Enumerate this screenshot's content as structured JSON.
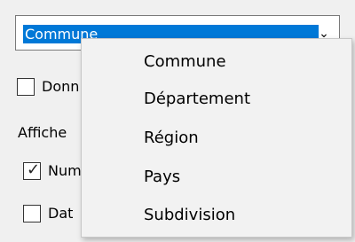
{
  "combo": {
    "selected": "Commune",
    "arrow_icon": "chevron-down-icon"
  },
  "background": {
    "donn_label": "Donn",
    "affiche_label": "Affiche",
    "num_label": "Num",
    "num_checked": true,
    "dat_label": "Dat"
  },
  "dropdown": {
    "items": [
      {
        "label": "Commune"
      },
      {
        "label": "Département"
      },
      {
        "label": "Région"
      },
      {
        "label": "Pays"
      },
      {
        "label": "Subdivision"
      }
    ]
  },
  "colors": {
    "selection": "#0078d7",
    "popup_bg": "#f2f2f2",
    "window_bg": "#f0f0f0"
  }
}
